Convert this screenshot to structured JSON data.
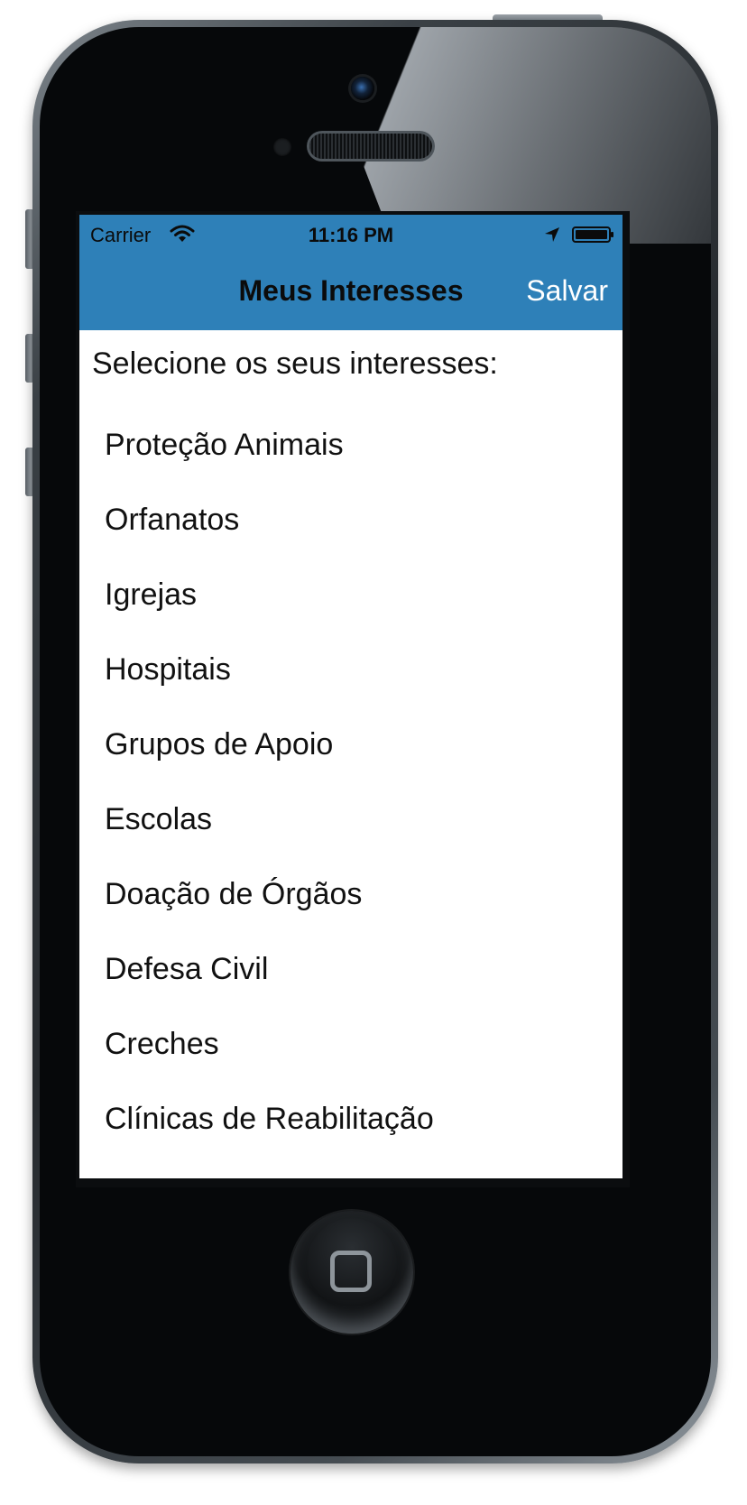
{
  "status_bar": {
    "carrier": "Carrier",
    "time": "11:16 PM",
    "icons": [
      "wifi-icon",
      "location-icon",
      "battery-icon"
    ]
  },
  "nav_bar": {
    "title": "Meus Interesses",
    "save_label": "Salvar",
    "background_color": "#2e80b8"
  },
  "content": {
    "instruction": "Selecione os seus interesses:",
    "interests": [
      "Proteção Animais",
      "Orfanatos",
      "Igrejas",
      "Hospitais",
      "Grupos de Apoio",
      "Escolas",
      "Doação de Órgãos",
      "Defesa Civil",
      "Creches",
      "Clínicas de Reabilitação"
    ]
  },
  "device": {
    "home_button_icon": "home-square-icon"
  }
}
